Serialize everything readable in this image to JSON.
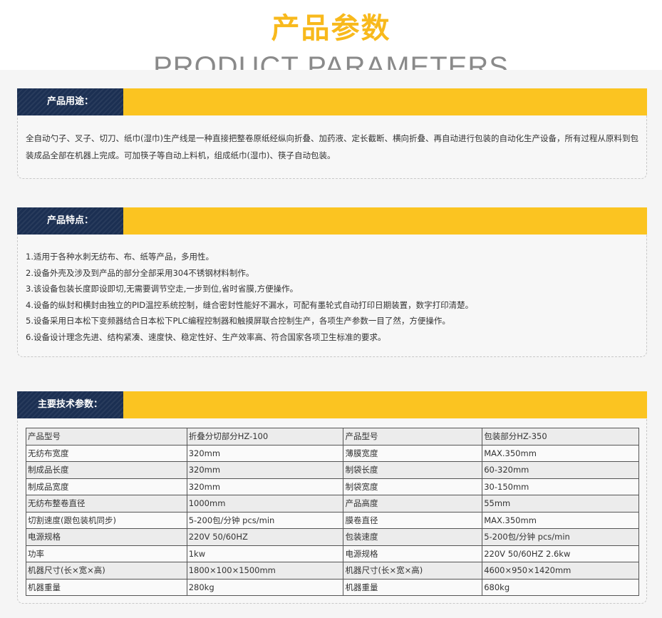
{
  "header": {
    "title": "产品参数",
    "subtitle": "PRODUCT PARAMETERS"
  },
  "usage": {
    "label": "产品用途：",
    "text": "全自动勺子、叉子、切刀、纸巾(湿巾)生产线是一种直接把整卷原纸经纵向折叠、加药液、定长截断、横向折叠、再自动进行包装的自动化生产设备，所有过程从原料到包装成品全部在机器上完成。可加筷子等自动上料机，组成纸巾(湿巾)、筷子自动包装。"
  },
  "features": {
    "label": "产品特点：",
    "items": [
      "1.适用于各种水刺无纺布、布、纸等产品，多用性。",
      "2.设备外壳及涉及到产品的部分全部采用304不锈钢材料制作。",
      "3.该设备包装长度即设即切,无需要调节空走,一步到位,省时省膜,方便操作。",
      "4.设备的纵封和横封由独立的PID温控系统控制，缝合密封性能好不漏水，可配有墨轮式自动打印日期装置，数字打印清楚。",
      "5.设备采用日本松下变频器结合日本松下PLC编程控制器和触摸屏联合控制生产，各项生产参数一目了然，方便操作。",
      "6.设备设计理念先进、结构紧凑、速度快、稳定性好、生产效率高、符合国家各项卫生标准的要求。"
    ]
  },
  "specs": {
    "label": "主要技术参数：",
    "rows": [
      [
        "产品型号",
        "折叠分切部分HZ-100",
        "产品型号",
        "包装部分HZ-350"
      ],
      [
        "无纺布宽度",
        "320mm",
        "薄膜宽度",
        "MAX.350mm"
      ],
      [
        "制成品长度",
        "320mm",
        "制袋长度",
        "60-320mm"
      ],
      [
        "制成品宽度",
        "320mm",
        "制袋宽度",
        "30-150mm"
      ],
      [
        "无纺布整卷直径",
        "1000mm",
        "产品高度",
        "55mm"
      ],
      [
        "切割速度(跟包装机同步)",
        "5-200包/分钟 pcs/min",
        "膜卷直径",
        "MAX.350mm"
      ],
      [
        "电源规格",
        "220V 50/60HZ",
        "包装速度",
        "5-200包/分钟 pcs/min"
      ],
      [
        "功率",
        "1kw",
        "电源规格",
        "220V 50/60HZ 2.6kw"
      ],
      [
        "机器尺寸(长×宽×高)",
        "1800×100×1500mm",
        "机器尺寸(长×宽×高)",
        "4600×950×1420mm"
      ],
      [
        "机器重量",
        "280kg",
        "机器重量",
        "680kg"
      ]
    ]
  }
}
